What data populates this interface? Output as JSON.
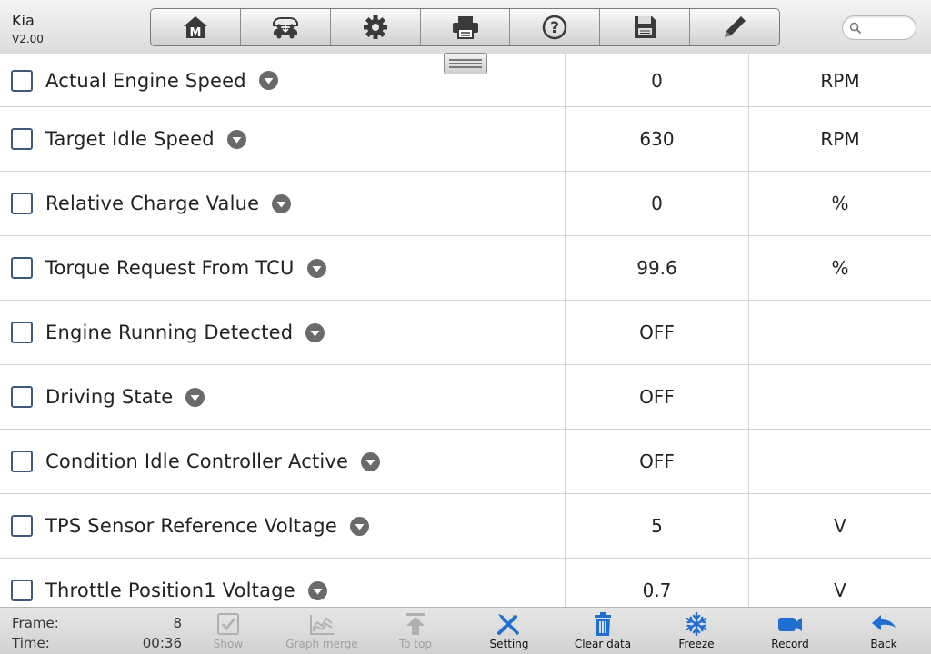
{
  "header": {
    "app_name": "Kia",
    "version": "V2.00",
    "toolbar": [
      {
        "name": "home-icon"
      },
      {
        "name": "vehicle-swap-icon"
      },
      {
        "name": "settings-gear-icon"
      },
      {
        "name": "printer-icon"
      },
      {
        "name": "help-icon"
      },
      {
        "name": "save-icon"
      },
      {
        "name": "edit-pencil-icon"
      }
    ],
    "search": {
      "placeholder": "",
      "value": ""
    }
  },
  "rows": [
    {
      "name": "Actual Engine Speed",
      "value": "0",
      "unit": "RPM"
    },
    {
      "name": "Target Idle Speed",
      "value": "630",
      "unit": "RPM"
    },
    {
      "name": "Relative Charge Value",
      "value": "0",
      "unit": "%"
    },
    {
      "name": "Torque Request From TCU",
      "value": "99.6",
      "unit": "%"
    },
    {
      "name": "Engine Running Detected",
      "value": "OFF",
      "unit": ""
    },
    {
      "name": "Driving State",
      "value": "OFF",
      "unit": ""
    },
    {
      "name": "Condition Idle Controller Active",
      "value": "OFF",
      "unit": ""
    },
    {
      "name": "TPS Sensor Reference Voltage",
      "value": "5",
      "unit": "V"
    },
    {
      "name": "Throttle Position1 Voltage",
      "value": "0.7",
      "unit": "V"
    }
  ],
  "footer": {
    "frame_label": "Frame:",
    "frame_value": "8",
    "time_label": "Time:",
    "time_value": "00:36",
    "buttons": {
      "show": "Show",
      "graph_merge": "Graph merge",
      "to_top": "To top",
      "setting": "Setting",
      "clear_data": "Clear data",
      "freeze": "Freeze",
      "record": "Record",
      "back": "Back"
    }
  },
  "colors": {
    "accent_blue": "#1f6fd1",
    "disabled_gray": "#a9a9a9"
  }
}
